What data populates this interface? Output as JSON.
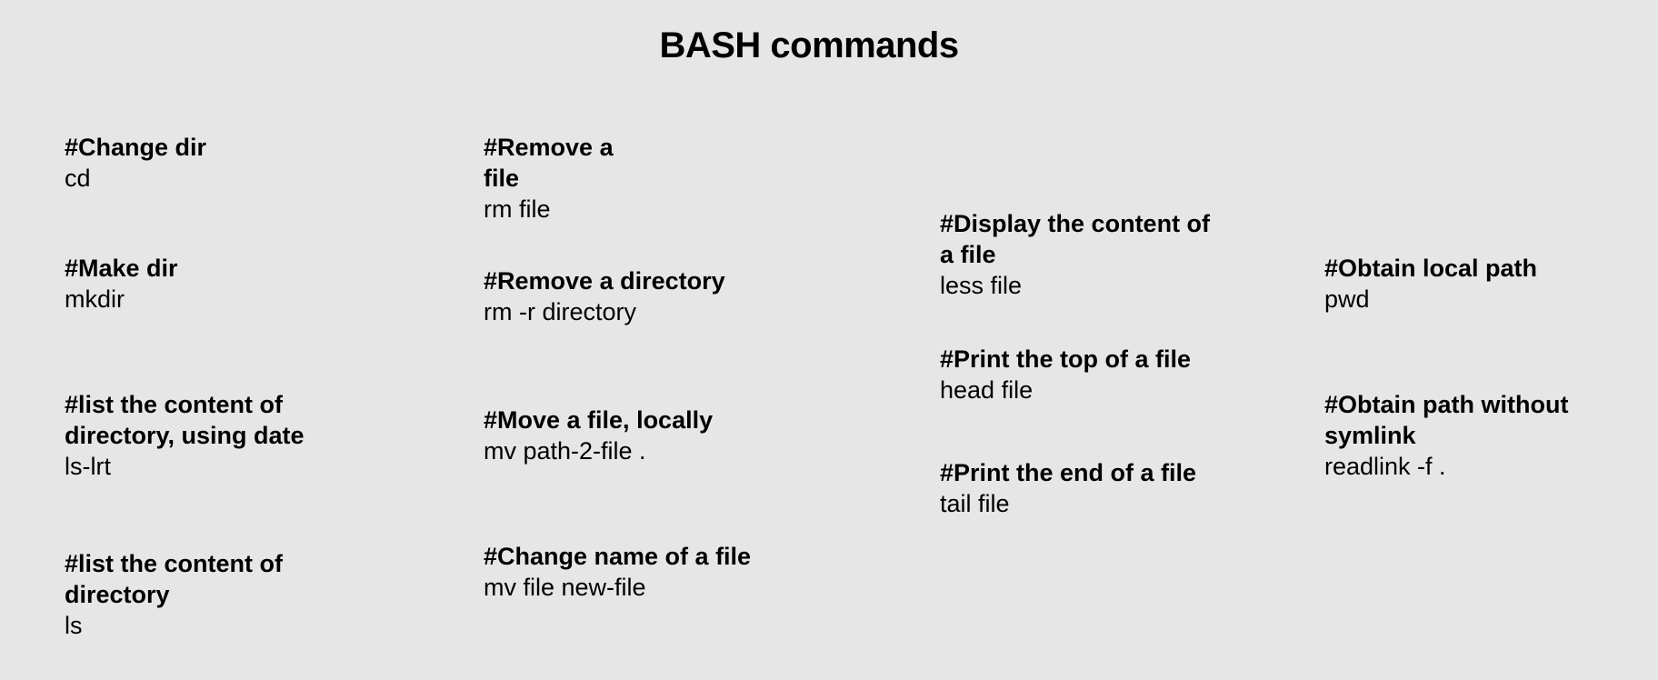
{
  "title": "BASH commands",
  "columns": [
    {
      "items": [
        {
          "heading": "#Change dir",
          "command": "cd"
        },
        {
          "heading": "#Make dir",
          "command": "mkdir"
        },
        {
          "heading_lines": [
            "#list the content of",
            "directory, using date"
          ],
          "command": "ls-lrt"
        },
        {
          "heading_lines": [
            "#list the content of",
            "directory"
          ],
          "command": "ls"
        }
      ]
    },
    {
      "items": [
        {
          "heading_lines": [
            "#Remove a",
            "file"
          ],
          "command": "rm file"
        },
        {
          "heading": "#Remove a directory",
          "command": "rm -r directory"
        },
        {
          "heading": "#Move a file, locally",
          "command": "mv path-2-file ."
        },
        {
          "heading": "#Change name of a file",
          "command": "mv file new-file"
        }
      ]
    },
    {
      "items": [
        {
          "heading_lines": [
            "#Display the content of",
            "a file"
          ],
          "command": "less file"
        },
        {
          "heading": "#Print the top of a file",
          "command": "head file"
        },
        {
          "heading": "#Print the end of a file",
          "command": "tail file"
        }
      ]
    },
    {
      "items": [
        {
          "heading": "#Obtain local path",
          "command": "pwd"
        },
        {
          "heading_lines": [
            "#Obtain path without",
            "symlink"
          ],
          "command": "readlink -f ."
        }
      ]
    }
  ]
}
